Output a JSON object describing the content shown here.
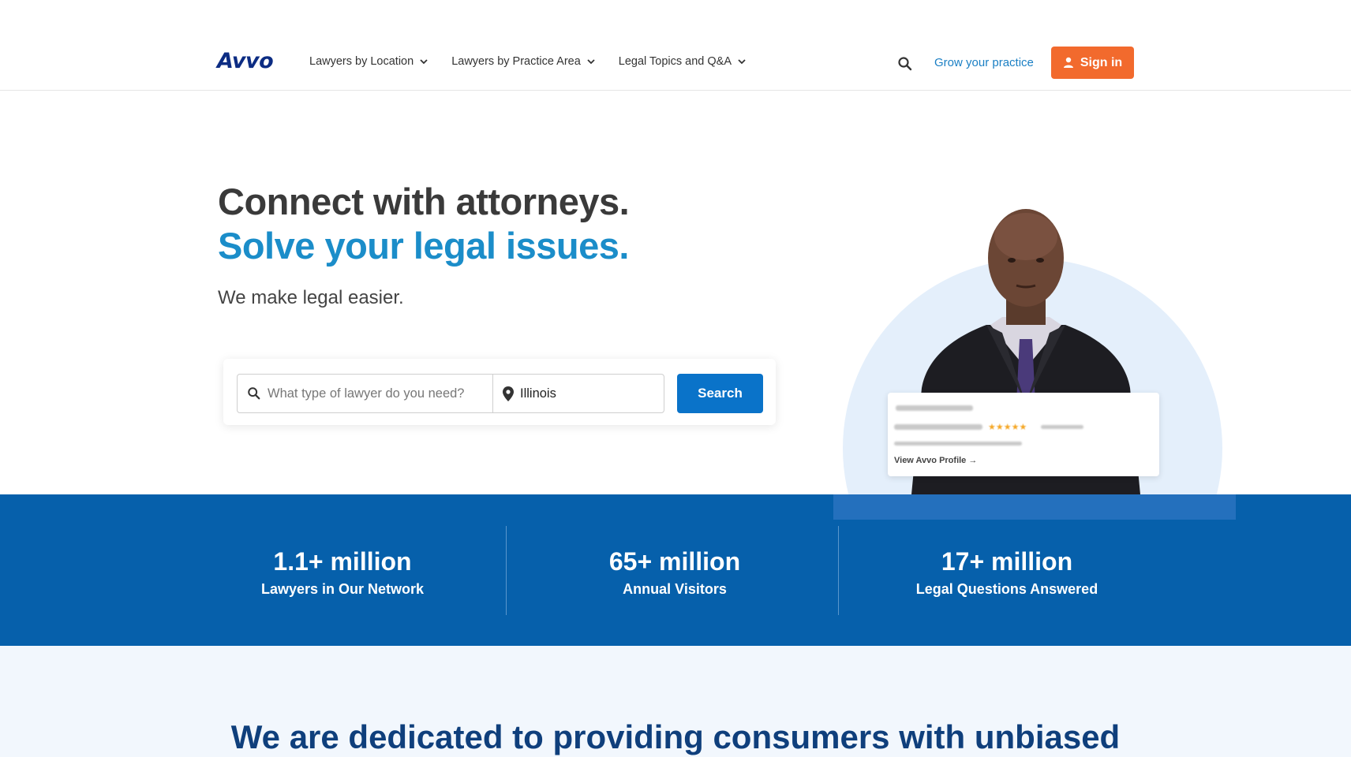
{
  "header": {
    "logo": "Avvo",
    "nav": [
      {
        "label": "Lawyers by Location"
      },
      {
        "label": "Lawyers by Practice Area"
      },
      {
        "label": "Legal Topics and Q&A"
      }
    ],
    "grow_link": "Grow your practice",
    "signin_label": "Sign in"
  },
  "hero": {
    "headline_1": "Connect with attorneys.",
    "headline_2": "Solve your legal issues.",
    "subheadline": "We make legal easier.",
    "search": {
      "what_placeholder": "What type of lawyer do you need?",
      "where_value": "Illinois",
      "button_label": "Search"
    },
    "profile_card": {
      "link_label": "View Avvo Profile →",
      "stars": "★★★★★"
    }
  },
  "stats": [
    {
      "value": "1.1+ million",
      "label": "Lawyers in Our Network"
    },
    {
      "value": "65+ million",
      "label": "Annual Visitors"
    },
    {
      "value": "17+ million",
      "label": "Legal Questions Answered"
    }
  ],
  "bottom": {
    "title": "We are dedicated to providing consumers with unbiased"
  },
  "colors": {
    "brand_navy": "#0c2c83",
    "accent_orange": "#f26a2d",
    "link_blue": "#1a7fc4",
    "hero_blue": "#1b8dc9",
    "button_blue": "#0a73c9",
    "stats_band": "#0660ab"
  }
}
